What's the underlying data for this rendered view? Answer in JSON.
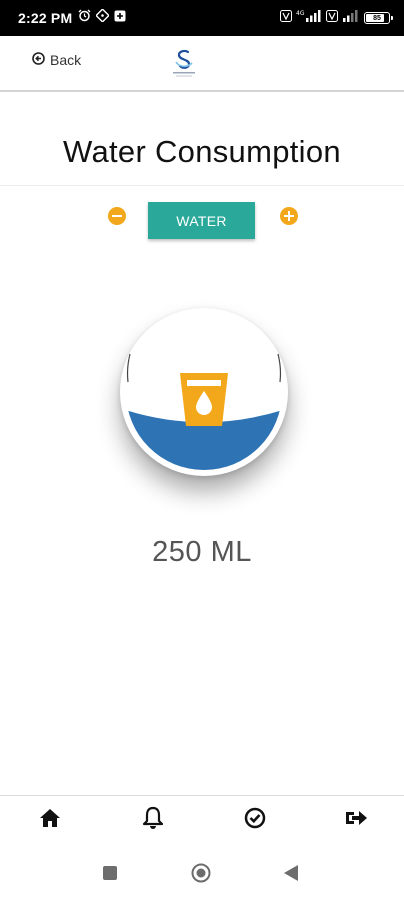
{
  "status_bar": {
    "time": "2:22 PM",
    "battery_text": "85",
    "battery_level": 0.85,
    "icons": [
      "alarm-icon",
      "location-icon",
      "notification-icon",
      "wifi-icon",
      "signal-icon",
      "signal-icon",
      "battery-icon"
    ]
  },
  "header": {
    "back_label": "Back",
    "logo_icon": "app-logo"
  },
  "page": {
    "title": "Water Consumption"
  },
  "controls": {
    "drink_label": "WATER",
    "decrease_icon": "minus-circle-icon",
    "increase_icon": "plus-circle-icon"
  },
  "gauge": {
    "fill_fraction": 0.35,
    "icon": "water-glass-icon"
  },
  "amount": {
    "text": "250 ML"
  },
  "bottom_nav": {
    "items": [
      "home-icon",
      "bell-icon",
      "check-circle-icon",
      "logout-icon"
    ]
  },
  "system_nav": {
    "items": [
      "recents-icon",
      "home-circle-icon",
      "back-triangle-icon"
    ]
  },
  "colors": {
    "accent_teal": "#2aa89a",
    "accent_orange": "#f3a81c",
    "water_blue": "#2e74b5",
    "status_bar_bg": "#000000"
  }
}
